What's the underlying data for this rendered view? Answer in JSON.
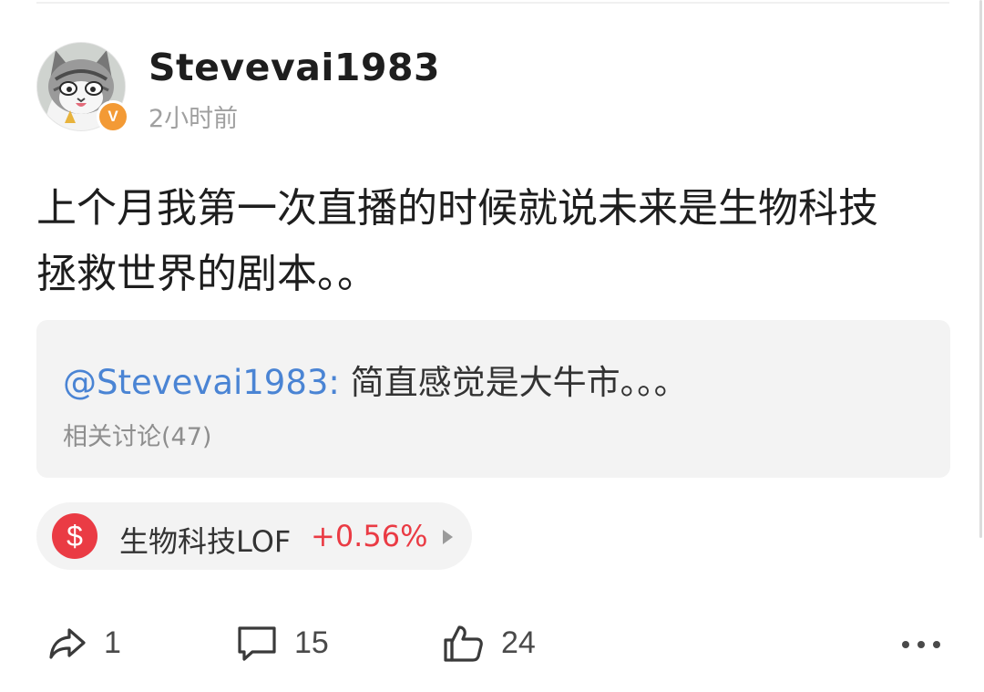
{
  "post": {
    "author": {
      "username": "Stevevai1983",
      "verified_badge": "V",
      "avatar_icon": "cartoon-cat-avatar"
    },
    "timestamp": "2小时前",
    "text_line1": "上个月我第一次直播的时候就说未来是生物科技",
    "text_line2": "拯救世界的剧本。。",
    "quote": {
      "mention": "@Stevevai1983:",
      "text": " 简直感觉是大牛市。。。",
      "related": "相关讨论(47)"
    },
    "stock": {
      "icon": "$",
      "name": "生物科技LOF",
      "change": "+0.56%",
      "change_color": "#ea3b44"
    },
    "actions": {
      "share_count": "1",
      "comment_count": "15",
      "like_count": "24"
    }
  },
  "colors": {
    "mention": "#4a84d4",
    "badge": "#f39a35",
    "stock_icon_bg": "#ea3b44",
    "card_bg": "#f3f3f3"
  }
}
